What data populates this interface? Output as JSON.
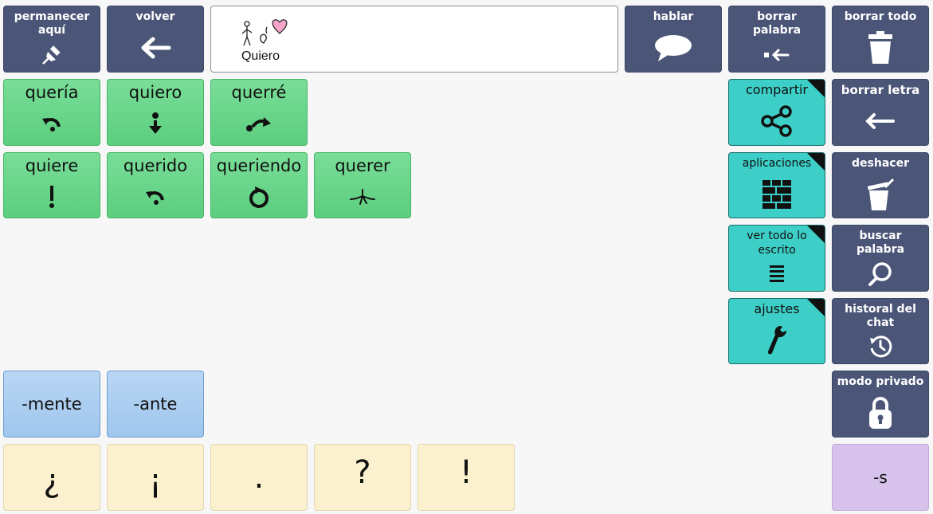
{
  "message": {
    "word": "Quiero",
    "symbol": "person-wants-heart-icon"
  },
  "toolbar": {
    "stay_here": "permanecer aquí",
    "back": "volver",
    "speak": "hablar",
    "delete_word": "borrar palabra",
    "clear_all": "borrar todo"
  },
  "conjugations": {
    "queria": "quería",
    "quiero": "quiero",
    "querre": "querré",
    "quiere": "quiere",
    "querido": "querido",
    "queriendo": "queriendo",
    "querer": "querer"
  },
  "suffixes": {
    "mente": "-mente",
    "ante": "-ante",
    "s": "-s"
  },
  "punctuation": {
    "inv_question": "¿",
    "inv_exclaim": "¡",
    "period": ".",
    "question": "?",
    "exclaim": "!"
  },
  "side": {
    "share": "compartir",
    "apps": "aplicaciones",
    "view_all": "ver todo lo escrito",
    "settings": "ajustes",
    "delete_letter": "borrar letra",
    "undo": "deshacer",
    "search_word": "buscar palabra",
    "chat_history": "historal del chat",
    "private_mode": "modo privado"
  },
  "colors": {
    "dark_button": "#4a5578",
    "verb_green": "#6ad68b",
    "action_teal": "#3dcfc7",
    "suffix_blue": "#aecff1",
    "punct_cream": "#fbf1ce",
    "plural_lilac": "#d6c2ea"
  }
}
